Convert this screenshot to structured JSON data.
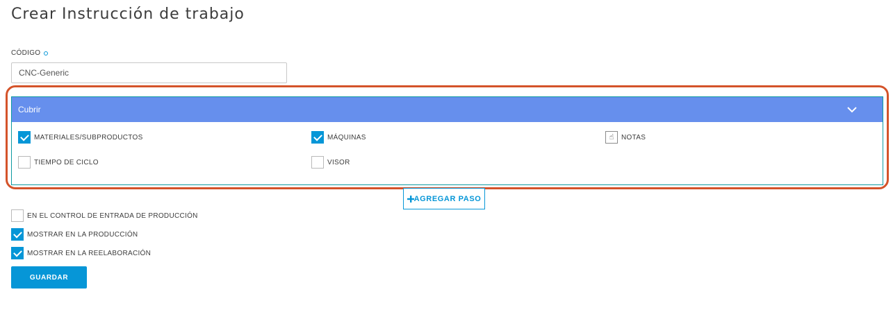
{
  "page": {
    "title": "Crear Instrucción de trabajo"
  },
  "code_field": {
    "label": "CÓDIGO",
    "value": "CNC-Generic"
  },
  "step_panel": {
    "title": "Cubrir",
    "options": [
      {
        "label": "MATERIALES/SUBPRODUCTOS",
        "checked": true
      },
      {
        "label": "MÁQUINAS",
        "checked": true
      },
      {
        "label": "NOTAS",
        "checked": false
      },
      {
        "label": "TIEMPO DE CICLO",
        "checked": false
      },
      {
        "label": "VISOR",
        "checked": false
      }
    ]
  },
  "add_step": {
    "label": "AGREGAR PASO",
    "icon": "plus-icon"
  },
  "settings": [
    {
      "label": "EN EL CONTROL DE ENTRADA DE PRODUCCIÓN",
      "checked": false
    },
    {
      "label": "MOSTRAR EN LA PRODUCCIÓN",
      "checked": true
    },
    {
      "label": "MOSTRAR EN LA REELABORACIÓN",
      "checked": true
    }
  ],
  "save_button": {
    "label": "GUARDAR"
  },
  "colors": {
    "accent": "#0696d7",
    "panel_header": "#668fed",
    "highlight": "#d4532a"
  }
}
